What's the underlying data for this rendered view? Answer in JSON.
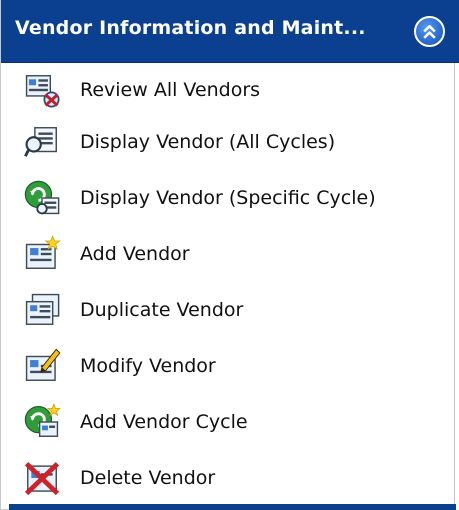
{
  "panel": {
    "title": "Vendor Information and Maint...",
    "collapse_icon": "double-chevron-up-icon",
    "header_color": "#0b3f8f"
  },
  "items": [
    {
      "label": "Review All Vendors",
      "icon": "review-vendors-icon"
    },
    {
      "label": "Display Vendor (All Cycles)",
      "icon": "display-vendor-icon"
    },
    {
      "label": "Display Vendor (Specific Cycle)",
      "icon": "display-vendor-cycle-icon"
    },
    {
      "label": "Add Vendor",
      "icon": "add-vendor-icon"
    },
    {
      "label": "Duplicate Vendor",
      "icon": "duplicate-vendor-icon"
    },
    {
      "label": "Modify Vendor",
      "icon": "modify-vendor-icon"
    },
    {
      "label": "Add Vendor Cycle",
      "icon": "add-vendor-cycle-icon"
    },
    {
      "label": "Delete Vendor",
      "icon": "delete-vendor-icon"
    }
  ]
}
